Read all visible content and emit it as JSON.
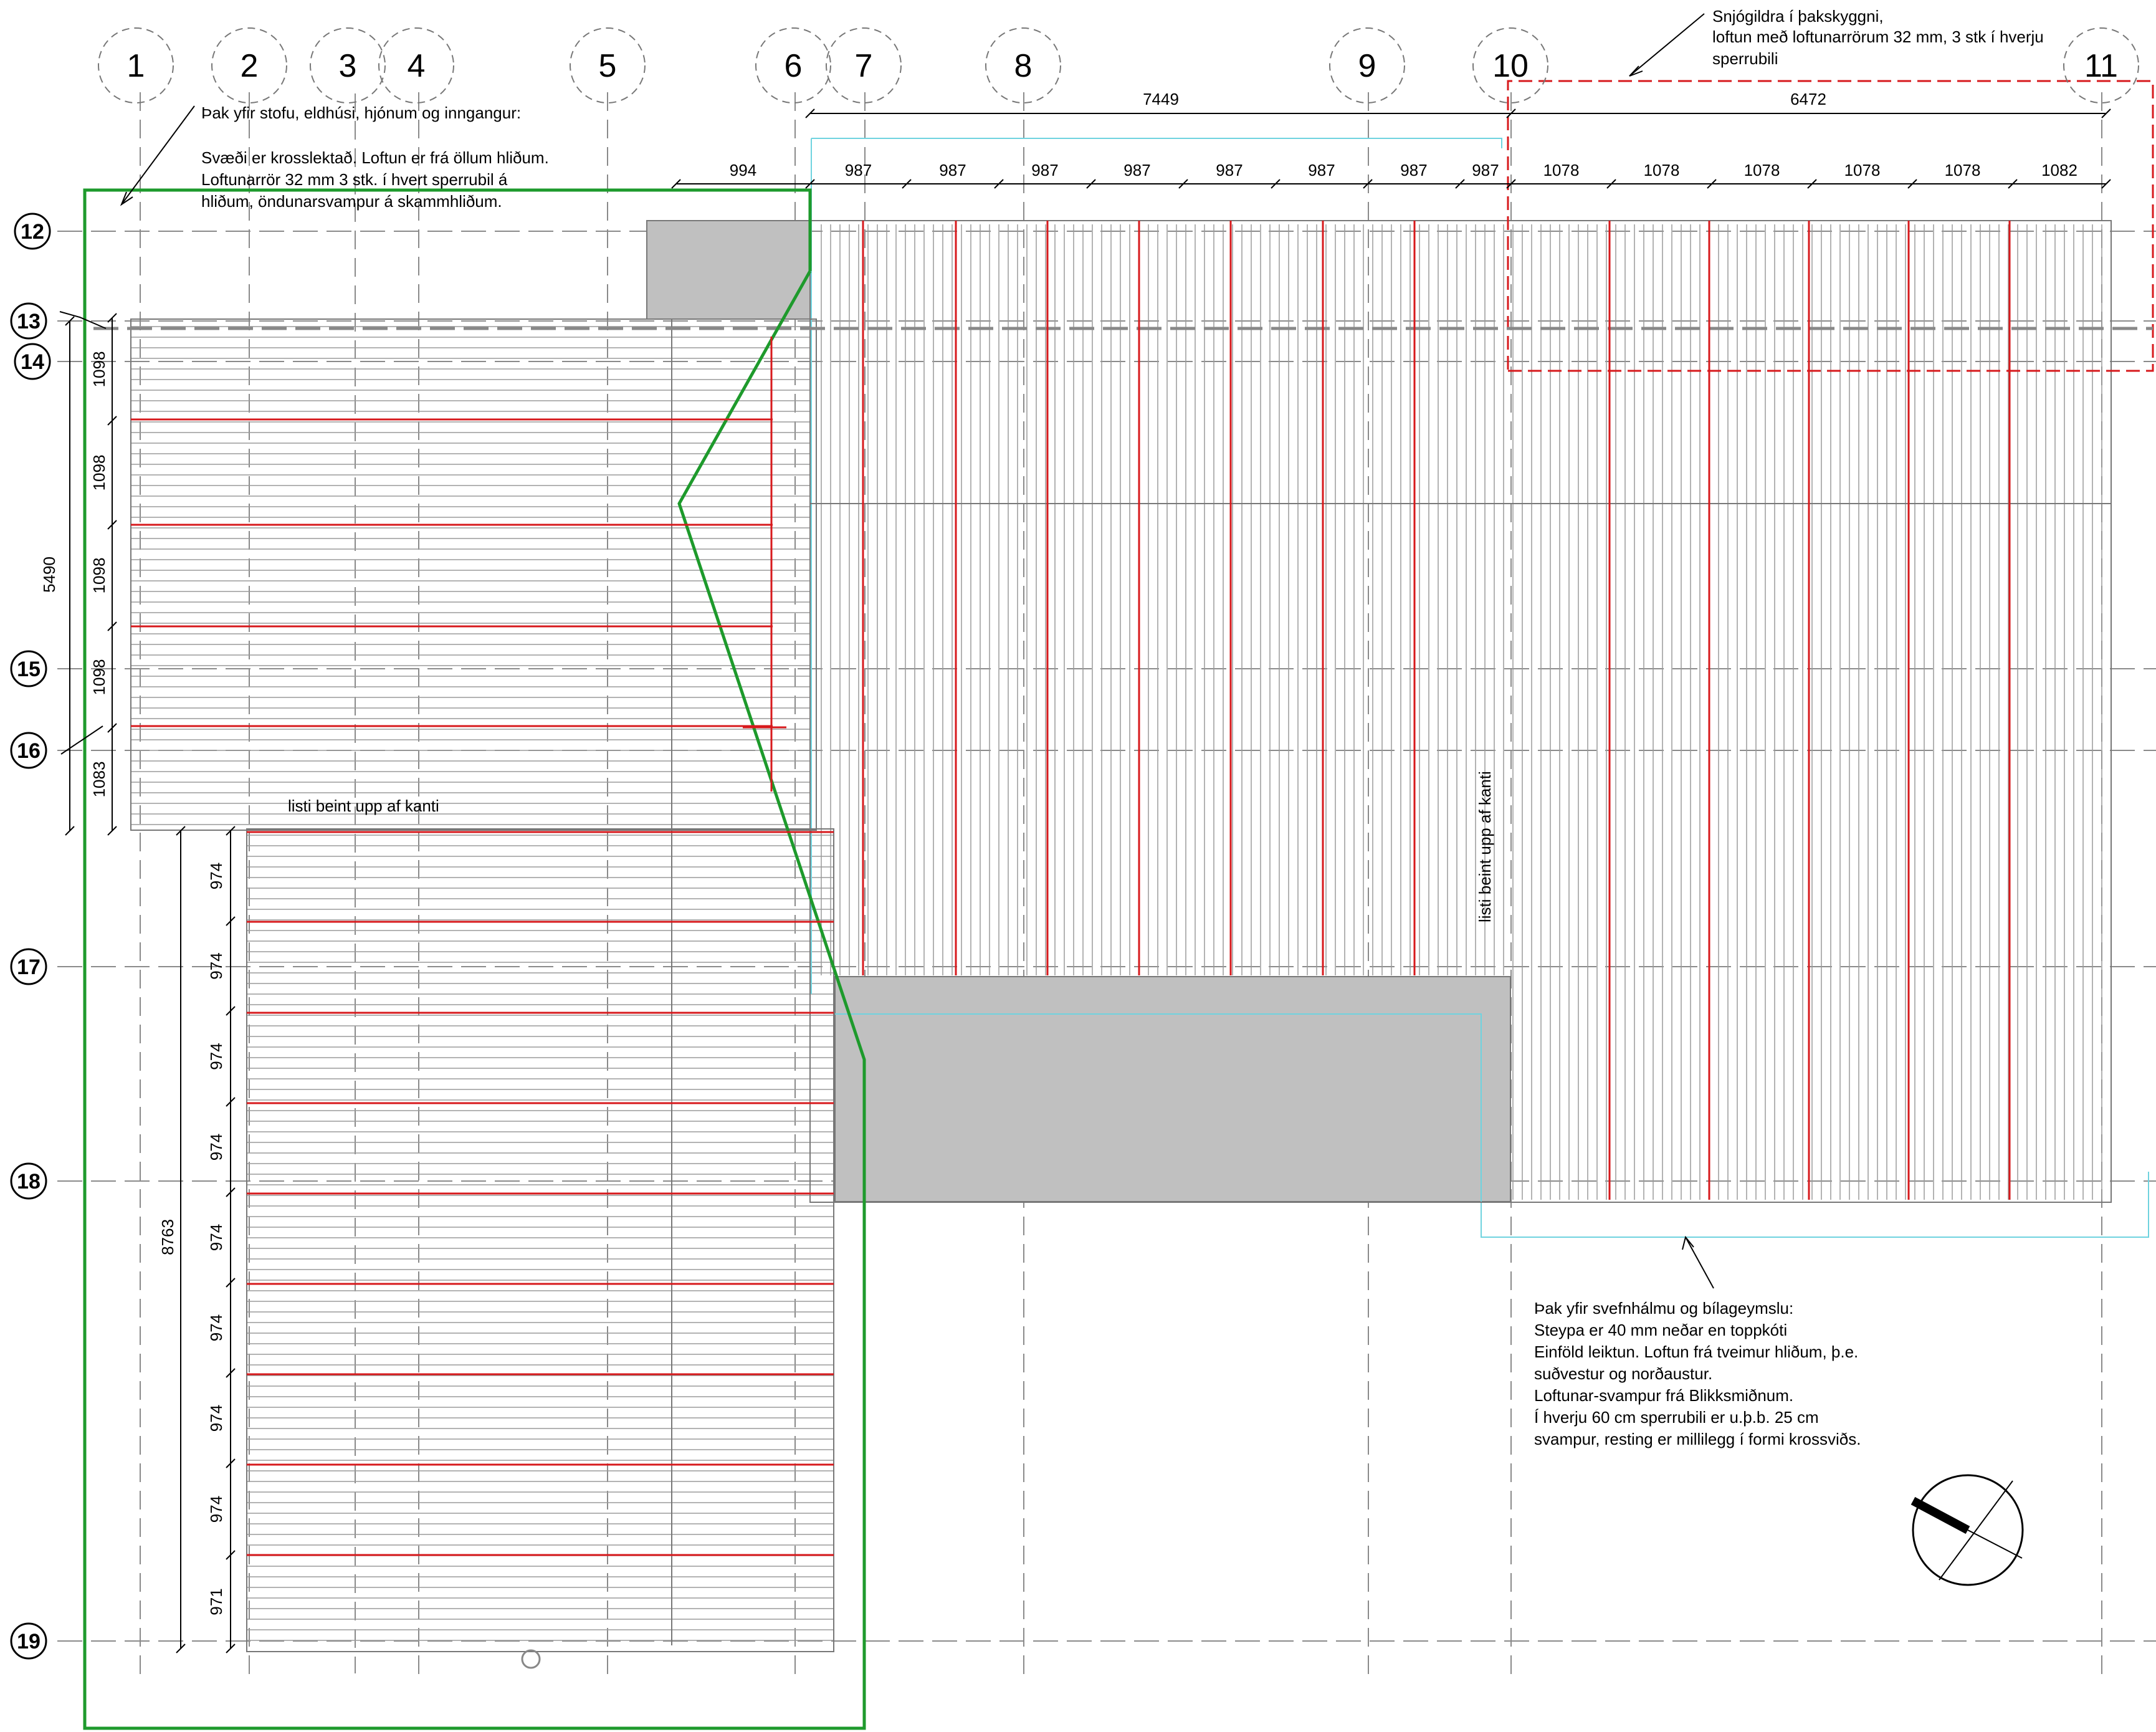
{
  "grid": {
    "vertical_labels": [
      "1",
      "2",
      "3",
      "4",
      "5",
      "6",
      "7",
      "8",
      "9",
      "10",
      "11"
    ],
    "horizontal_labels": [
      "12",
      "13",
      "14",
      "15",
      "16",
      "17",
      "18",
      "19"
    ]
  },
  "dimensions": {
    "top_overall_left": "7449",
    "top_overall_right": "6472",
    "top_segments": [
      "994",
      "987",
      "987",
      "987",
      "987",
      "987",
      "987",
      "987",
      "987",
      "1078",
      "1078",
      "1078",
      "1078",
      "1078",
      "1082"
    ],
    "left_overall_upper": "5490",
    "left_segments_upper": [
      "1098",
      "1098",
      "1098",
      "1098",
      "1083"
    ],
    "left_overall_lower": "8763",
    "left_segments_lower": [
      "974",
      "974",
      "974",
      "974",
      "974",
      "974",
      "974",
      "974",
      "971"
    ]
  },
  "notes": {
    "living_roof": [
      "Þak yfir stofu, eldhúsi, hjónum og inngangur:",
      "Svæði er krosslektað.  Loftun er frá öllum hliðum.",
      "Loftunarrör 32 mm 3 stk. í hvert sperrubil á",
      "hliðum, öndunarsvampur á skammhliðum."
    ],
    "snow_guard": [
      "Snjógildra í þakskyggni,",
      "loftun með loftunarrörum 32 mm, 3 stk í hverju",
      "sperrubili"
    ],
    "bedroom_roof": [
      "Þak yfir svefnhálmu og bílageymslu:",
      "Steypa er 40 mm neðar en toppkóti",
      "Einföld leiktun.  Loftun frá tveimur hliðum, þ.e.",
      "suðvestur og norðaustur.",
      "Loftunar-svampur frá Blikksmiðnum.",
      "Í hverju 60 cm sperrubili er u.þ.b. 25 cm",
      "svampur, resting er millilegg í formi krossviðs."
    ],
    "edge_strip_horizontal": "listi beint upp af kanti",
    "edge_strip_vertical": "listi beint upp af kanti"
  },
  "colors": {
    "line": "#000000",
    "batten": "#9a9a9a",
    "rafter_red": "#d7191c",
    "zone_green": "#1e9a2c",
    "snow_zone_red": "#d7191c",
    "cyan_outline": "#6fd3df",
    "fill_gray": "#c0c0c0",
    "grid_gray": "#8a8a8a"
  },
  "icons": [
    "north-arrow-icon"
  ]
}
